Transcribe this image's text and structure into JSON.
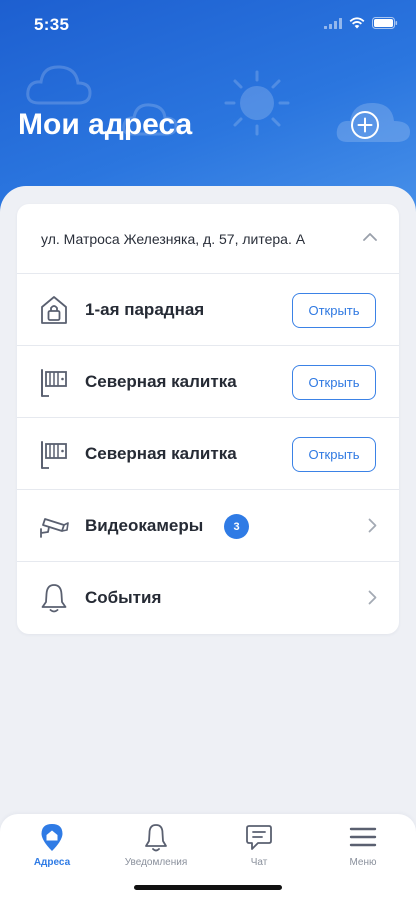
{
  "status": {
    "time": "5:35"
  },
  "header": {
    "title": "Мои адреса"
  },
  "address": {
    "text": "ул. Матроса Железняка, д. 57, литера. А"
  },
  "rows": [
    {
      "label": "1-ая парадная",
      "icon": "entrance-lock-icon",
      "button": "Открыть"
    },
    {
      "label": "Северная калитка",
      "icon": "gate-icon",
      "button": "Открыть"
    },
    {
      "label": "Северная калитка",
      "icon": "gate-icon",
      "button": "Открыть"
    },
    {
      "label": "Видеокамеры",
      "icon": "camera-icon",
      "badge": "3"
    },
    {
      "label": "События",
      "icon": "bell-icon"
    }
  ],
  "tabs": [
    {
      "label": "Адреса",
      "icon": "home-pin-icon",
      "active": true
    },
    {
      "label": "Уведомления",
      "icon": "bell-icon"
    },
    {
      "label": "Чат",
      "icon": "chat-icon"
    },
    {
      "label": "Меню",
      "icon": "menu-icon"
    }
  ],
  "colors": {
    "accent": "#2f7be5",
    "header_gradient_start": "#1d5fd0",
    "header_gradient_end": "#4a93ea"
  }
}
